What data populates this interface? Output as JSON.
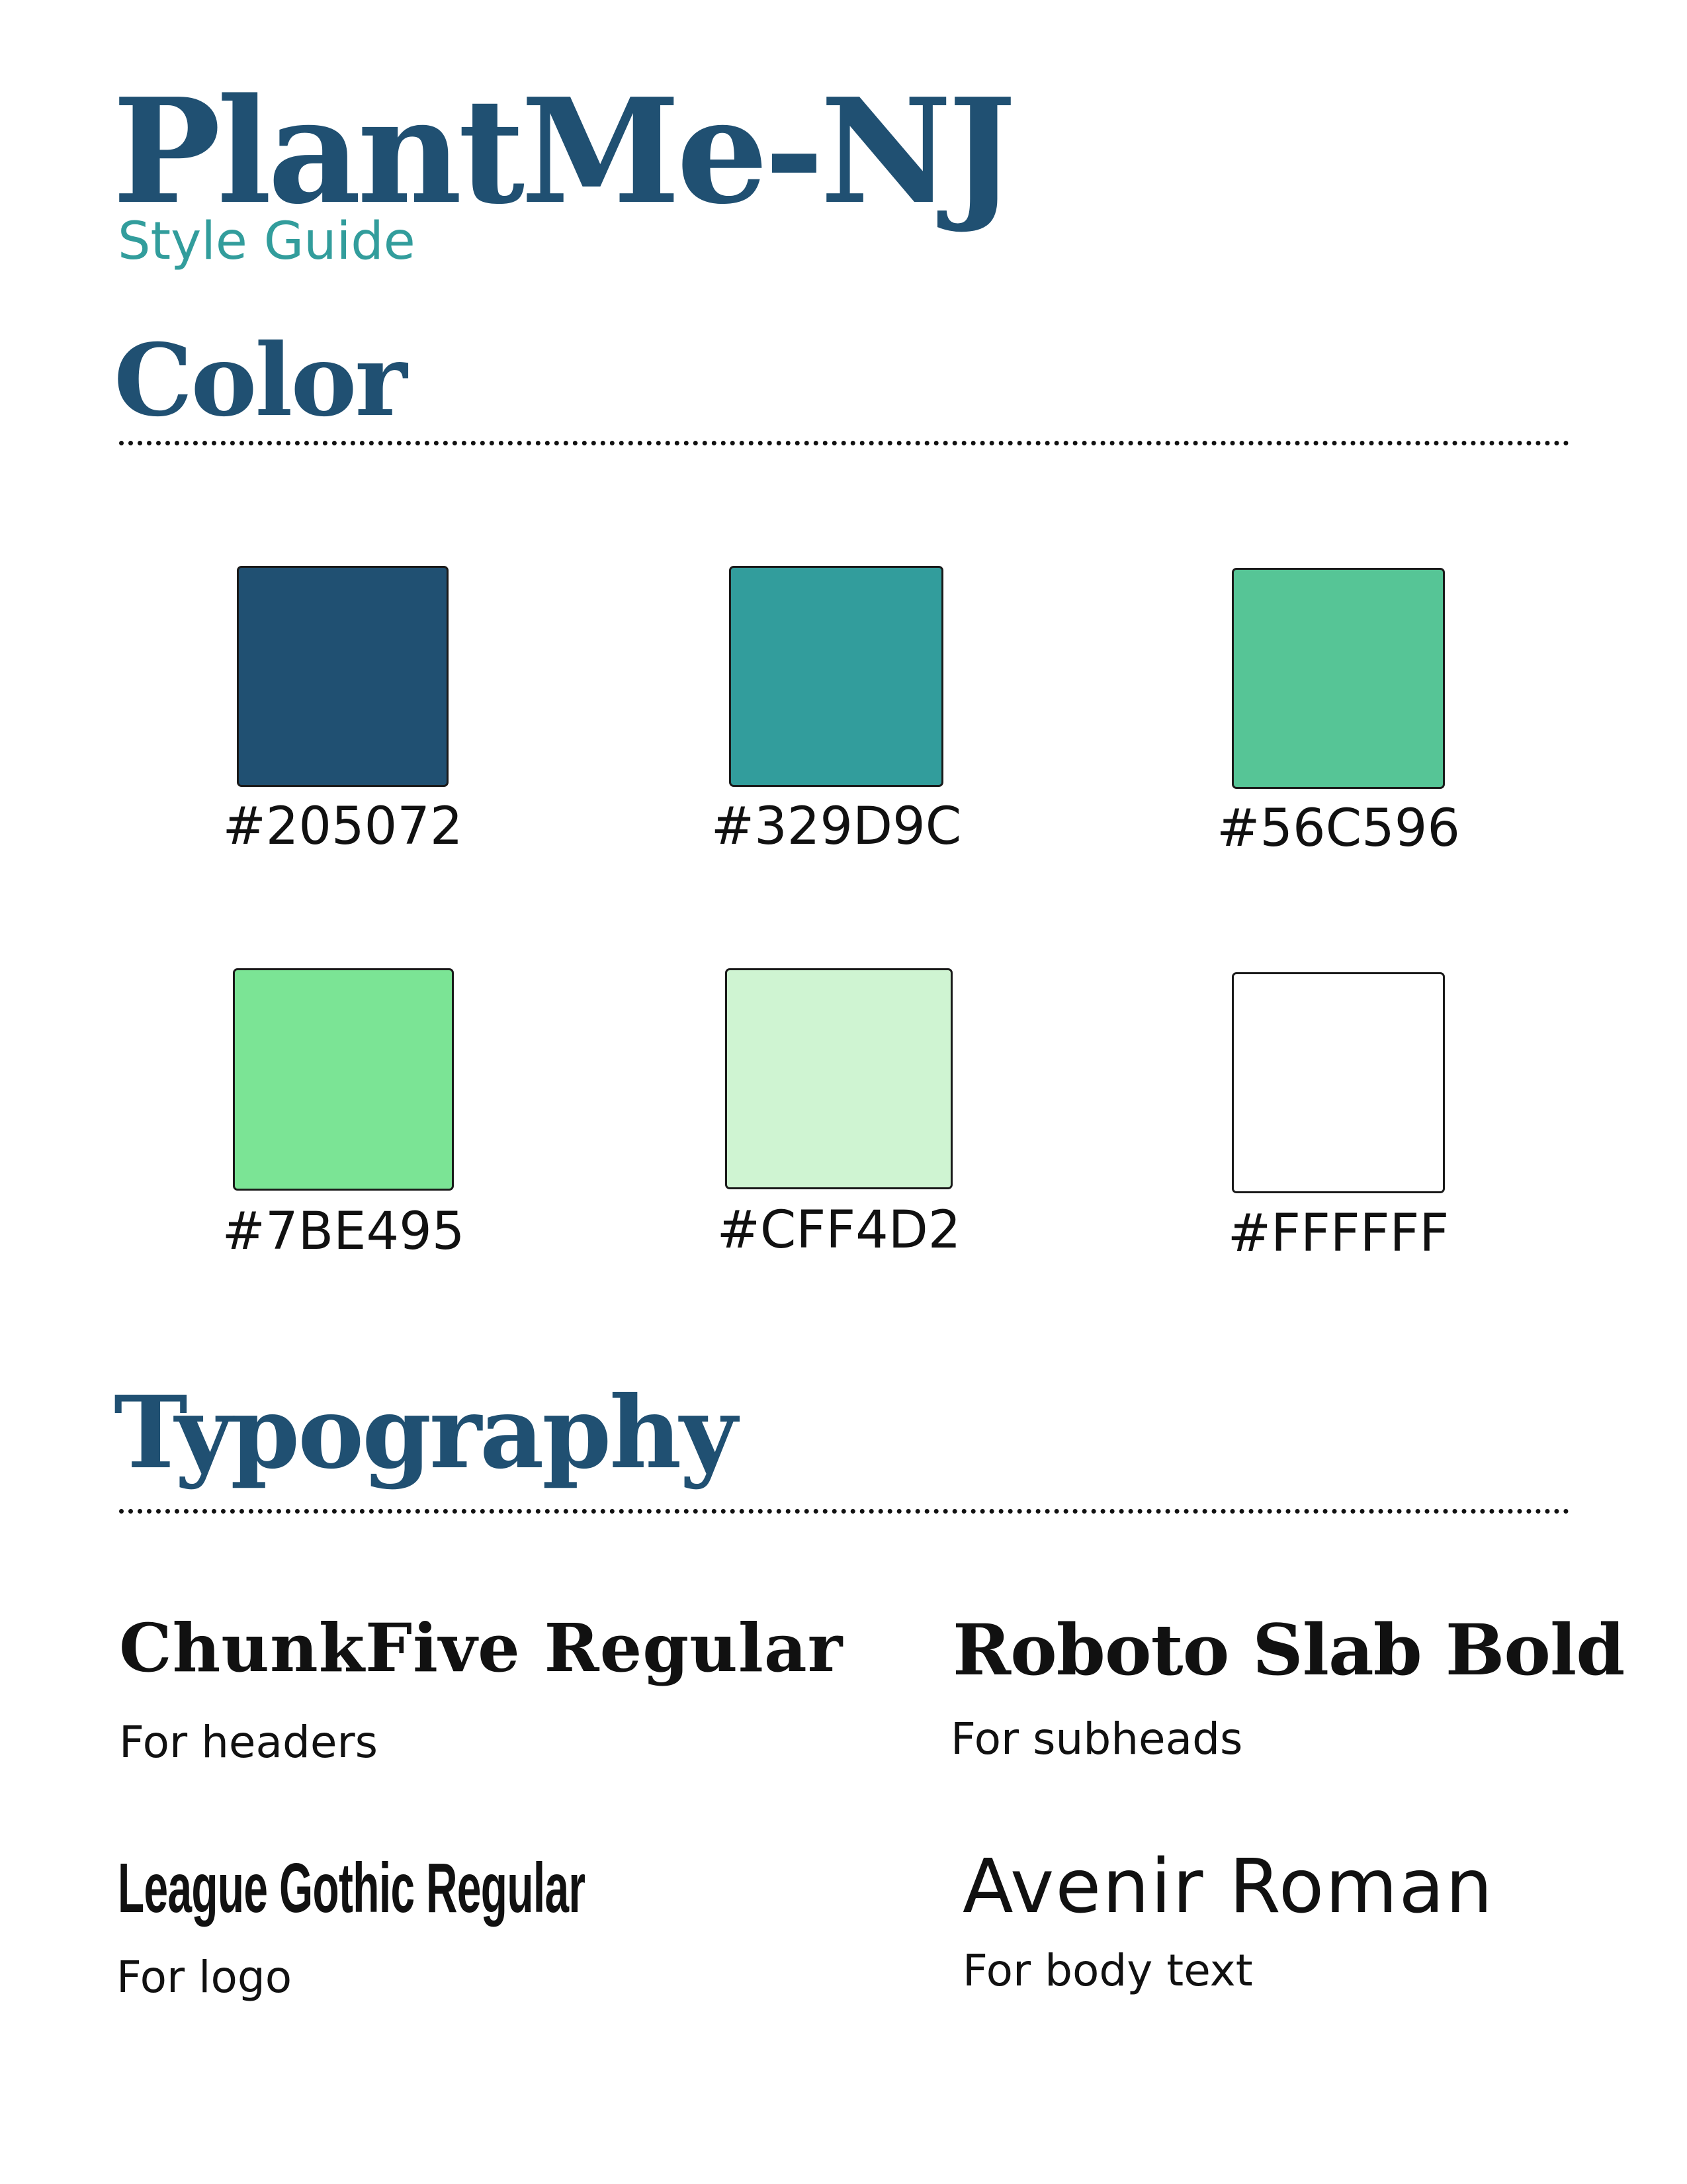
{
  "header": {
    "title": "PlantMe-NJ",
    "subtitle": "Style Guide"
  },
  "color_section": {
    "heading": "Color",
    "swatches": [
      {
        "label": "#205072",
        "color": "#205072"
      },
      {
        "label": "#329D9C",
        "color": "#329D9C"
      },
      {
        "label": "#56C596",
        "color": "#56C596"
      },
      {
        "label": "#7BE495",
        "color": "#7BE495"
      },
      {
        "label": "#CFF4D2",
        "color": "#CFF4D2"
      },
      {
        "label": "#FFFFFF",
        "color": "#FFFFFF"
      }
    ]
  },
  "typography_section": {
    "heading": "Typography",
    "fonts": [
      {
        "name": "ChunkFive Regular",
        "use": "For headers"
      },
      {
        "name": "Roboto Slab Bold",
        "use": "For subheads"
      },
      {
        "name": "League Gothic Regular",
        "use": "For logo"
      },
      {
        "name": "Avenir Roman",
        "use": "For body text"
      }
    ]
  }
}
